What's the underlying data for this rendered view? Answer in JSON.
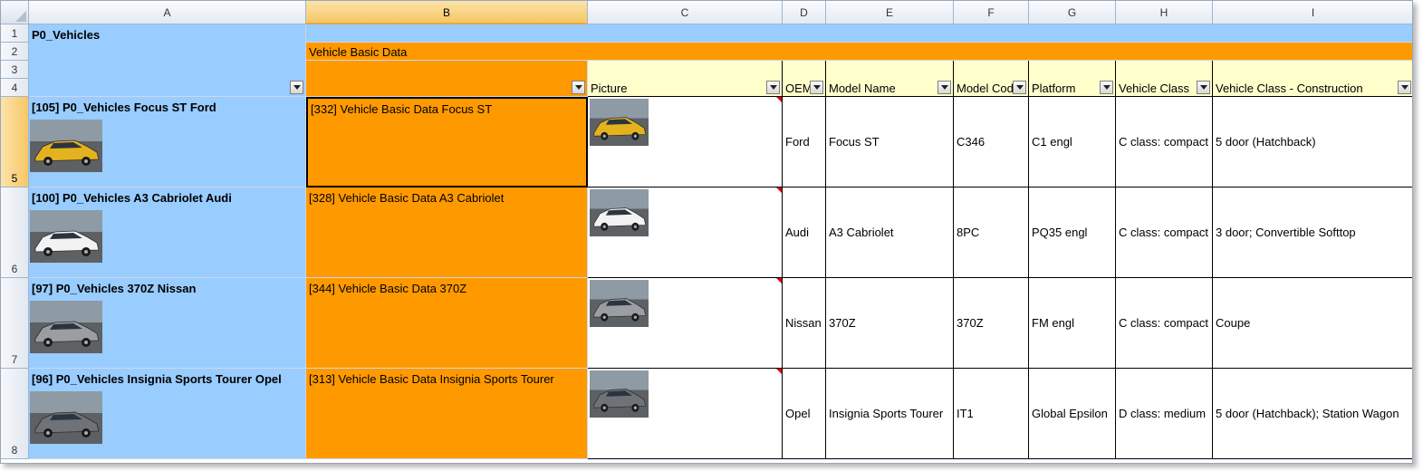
{
  "columns": [
    "A",
    "B",
    "C",
    "D",
    "E",
    "F",
    "G",
    "H",
    "I"
  ],
  "rows": [
    "1",
    "2",
    "3",
    "4",
    "5",
    "6",
    "7",
    "8"
  ],
  "header": {
    "group_a": "P0_Vehicles",
    "group_b": "Vehicle Basic Data",
    "fields": {
      "picture": "Picture",
      "oem": "OEM",
      "model_name": "Model Name",
      "model_code": "Model Code",
      "platform": "Platform",
      "vehicle_class": "Vehicle Class",
      "construction": "Vehicle Class - Construction"
    }
  },
  "records": [
    {
      "vehicle": "[105] P0_Vehicles Focus ST Ford",
      "basic": "[332] Vehicle Basic Data Focus ST",
      "oem": "Ford",
      "model_name": "Focus ST",
      "model_code": "C346",
      "platform": "C1 engl",
      "vehicle_class": "C class: compact",
      "construction": "5 door (Hatchback)",
      "car_color": "#e3b21e"
    },
    {
      "vehicle": "[100] P0_Vehicles A3 Cabriolet Audi",
      "basic": "[328] Vehicle Basic Data A3 Cabriolet",
      "oem": "Audi",
      "model_name": "A3 Cabriolet",
      "model_code": "8PC",
      "platform": "PQ35 engl",
      "vehicle_class": "C class: compact",
      "construction": "3 door; Convertible Softtop",
      "car_color": "#f2f2f2"
    },
    {
      "vehicle": "[97] P0_Vehicles 370Z Nissan",
      "basic": "[344] Vehicle Basic Data 370Z",
      "oem": "Nissan",
      "model_name": "370Z",
      "model_code": "370Z",
      "platform": "FM engl",
      "vehicle_class": "C class: compact",
      "construction": "Coupe",
      "car_color": "#9a9da2"
    },
    {
      "vehicle": "[96] P0_Vehicles Insignia Sports Tourer Opel",
      "basic": "[313] Vehicle Basic Data Insignia Sports Tourer",
      "oem": "Opel",
      "model_name": "Insignia Sports Tourer",
      "model_code": "IT1",
      "platform": "Global Epsilon",
      "vehicle_class": "D class: medium",
      "construction": "5 door (Hatchback); Station Wagon",
      "car_color": "#6f7378"
    }
  ],
  "colors": {
    "blue_fill": "#99ccff",
    "orange_fill": "#ff9900",
    "header_yellow": "#ffffcc",
    "comment_marker": "#e00000"
  },
  "icons": {
    "filter": "filter-dropdown-icon",
    "picture": "car-photo-icon"
  }
}
